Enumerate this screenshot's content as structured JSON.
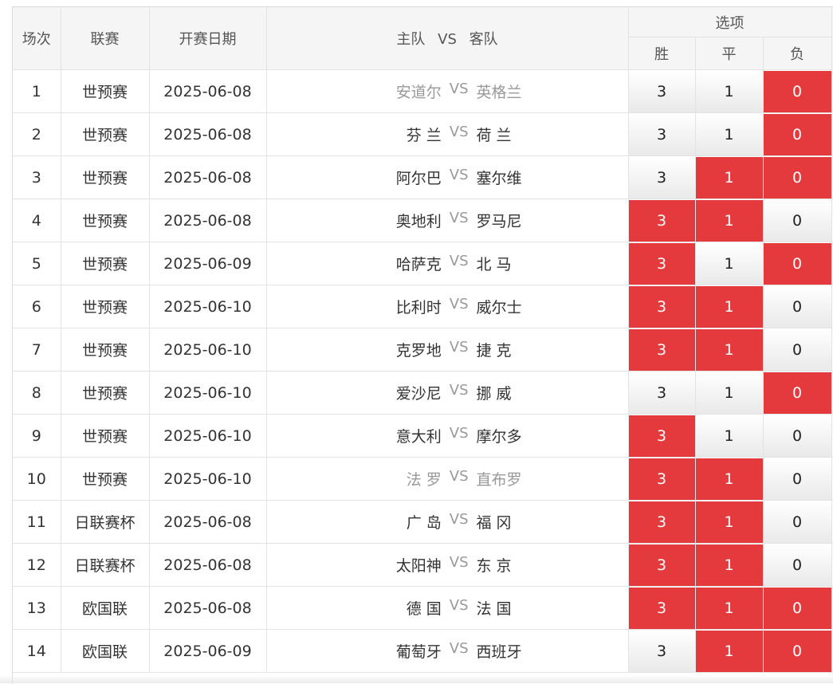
{
  "header": {
    "col_index": "场次",
    "col_league": "联赛",
    "col_date": "开赛日期",
    "col_home": "主队",
    "col_vs": "VS",
    "col_away": "客队",
    "col_options": "选项",
    "opt_win": "胜",
    "opt_draw": "平",
    "opt_lose": "负"
  },
  "colors": {
    "selected": "#e43a3d",
    "muted_text": "#999999"
  },
  "rows": [
    {
      "no": "1",
      "league": "世预赛",
      "date": "2025-06-08",
      "home": "安道尔",
      "vs": "VS",
      "away": "英格兰",
      "muted": true,
      "options": [
        {
          "label": "3",
          "selected": false
        },
        {
          "label": "1",
          "selected": false
        },
        {
          "label": "0",
          "selected": true
        }
      ]
    },
    {
      "no": "2",
      "league": "世预赛",
      "date": "2025-06-08",
      "home": "芬 兰",
      "vs": "VS",
      "away": "荷 兰",
      "muted": false,
      "options": [
        {
          "label": "3",
          "selected": false
        },
        {
          "label": "1",
          "selected": false
        },
        {
          "label": "0",
          "selected": true
        }
      ]
    },
    {
      "no": "3",
      "league": "世预赛",
      "date": "2025-06-08",
      "home": "阿尔巴",
      "vs": "VS",
      "away": "塞尔维",
      "muted": false,
      "options": [
        {
          "label": "3",
          "selected": false
        },
        {
          "label": "1",
          "selected": true
        },
        {
          "label": "0",
          "selected": true
        }
      ]
    },
    {
      "no": "4",
      "league": "世预赛",
      "date": "2025-06-08",
      "home": "奥地利",
      "vs": "VS",
      "away": "罗马尼",
      "muted": false,
      "options": [
        {
          "label": "3",
          "selected": true
        },
        {
          "label": "1",
          "selected": true
        },
        {
          "label": "0",
          "selected": false
        }
      ]
    },
    {
      "no": "5",
      "league": "世预赛",
      "date": "2025-06-09",
      "home": "哈萨克",
      "vs": "VS",
      "away": "北 马",
      "muted": false,
      "options": [
        {
          "label": "3",
          "selected": true
        },
        {
          "label": "1",
          "selected": false
        },
        {
          "label": "0",
          "selected": true
        }
      ]
    },
    {
      "no": "6",
      "league": "世预赛",
      "date": "2025-06-10",
      "home": "比利时",
      "vs": "VS",
      "away": "威尔士",
      "muted": false,
      "options": [
        {
          "label": "3",
          "selected": true
        },
        {
          "label": "1",
          "selected": true
        },
        {
          "label": "0",
          "selected": false
        }
      ]
    },
    {
      "no": "7",
      "league": "世预赛",
      "date": "2025-06-10",
      "home": "克罗地",
      "vs": "VS",
      "away": "捷 克",
      "muted": false,
      "options": [
        {
          "label": "3",
          "selected": true
        },
        {
          "label": "1",
          "selected": true
        },
        {
          "label": "0",
          "selected": false
        }
      ]
    },
    {
      "no": "8",
      "league": "世预赛",
      "date": "2025-06-10",
      "home": "爱沙尼",
      "vs": "VS",
      "away": "挪 威",
      "muted": false,
      "options": [
        {
          "label": "3",
          "selected": false
        },
        {
          "label": "1",
          "selected": false
        },
        {
          "label": "0",
          "selected": true
        }
      ]
    },
    {
      "no": "9",
      "league": "世预赛",
      "date": "2025-06-10",
      "home": "意大利",
      "vs": "VS",
      "away": "摩尔多",
      "muted": false,
      "options": [
        {
          "label": "3",
          "selected": true
        },
        {
          "label": "1",
          "selected": false
        },
        {
          "label": "0",
          "selected": false
        }
      ]
    },
    {
      "no": "10",
      "league": "世预赛",
      "date": "2025-06-10",
      "home": "法 罗",
      "vs": "VS",
      "away": "直布罗",
      "muted": true,
      "options": [
        {
          "label": "3",
          "selected": true
        },
        {
          "label": "1",
          "selected": true
        },
        {
          "label": "0",
          "selected": false
        }
      ]
    },
    {
      "no": "11",
      "league": "日联赛杯",
      "date": "2025-06-08",
      "home": "广 岛",
      "vs": "VS",
      "away": "福 冈",
      "muted": false,
      "options": [
        {
          "label": "3",
          "selected": true
        },
        {
          "label": "1",
          "selected": true
        },
        {
          "label": "0",
          "selected": false
        }
      ]
    },
    {
      "no": "12",
      "league": "日联赛杯",
      "date": "2025-06-08",
      "home": "太阳神",
      "vs": "VS",
      "away": "东 京",
      "muted": false,
      "options": [
        {
          "label": "3",
          "selected": true
        },
        {
          "label": "1",
          "selected": true
        },
        {
          "label": "0",
          "selected": false
        }
      ]
    },
    {
      "no": "13",
      "league": "欧国联",
      "date": "2025-06-08",
      "home": "德 国",
      "vs": "VS",
      "away": "法 国",
      "muted": false,
      "options": [
        {
          "label": "3",
          "selected": true
        },
        {
          "label": "1",
          "selected": true
        },
        {
          "label": "0",
          "selected": true
        }
      ]
    },
    {
      "no": "14",
      "league": "欧国联",
      "date": "2025-06-09",
      "home": "葡萄牙",
      "vs": "VS",
      "away": "西班牙",
      "muted": false,
      "options": [
        {
          "label": "3",
          "selected": false
        },
        {
          "label": "1",
          "selected": true
        },
        {
          "label": "0",
          "selected": true
        }
      ]
    }
  ]
}
